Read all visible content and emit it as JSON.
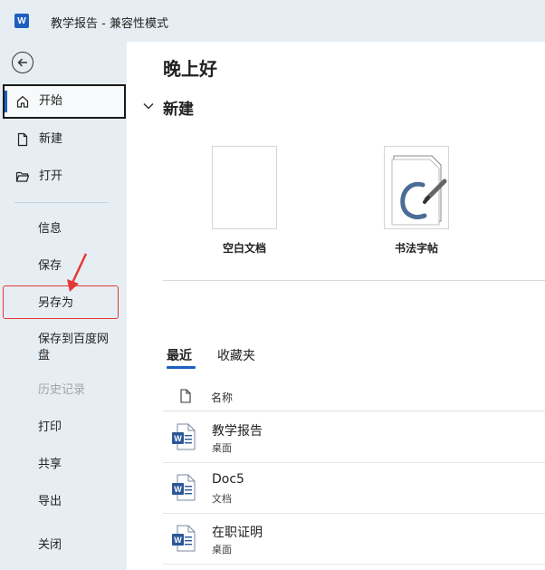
{
  "titlebar": {
    "app_letter": "W",
    "title": "教学报告  -  兼容性模式"
  },
  "sidebar": {
    "primary": [
      {
        "label": "开始",
        "icon": "home-icon",
        "active": true
      },
      {
        "label": "新建",
        "icon": "new-document-icon",
        "active": false
      },
      {
        "label": "打开",
        "icon": "folder-open-icon",
        "active": false
      }
    ],
    "secondary": [
      {
        "label": "信息",
        "disabled": false
      },
      {
        "label": "保存",
        "disabled": false
      },
      {
        "label": "另存为",
        "disabled": false,
        "highlighted": true
      },
      {
        "label": "保存到百度网盘",
        "disabled": false
      },
      {
        "label": "历史记录",
        "disabled": true
      },
      {
        "label": "打印",
        "disabled": false
      },
      {
        "label": "共享",
        "disabled": false
      },
      {
        "label": "导出",
        "disabled": false
      },
      {
        "label": "关闭",
        "disabled": false
      }
    ],
    "highlight_color": "#e53935"
  },
  "main": {
    "greeting": "晚上好",
    "new_section_title": "新建",
    "templates": [
      {
        "label": "空白文档",
        "icon": "blank-document-icon"
      },
      {
        "label": "书法字帖",
        "icon": "calligraphy-template-icon"
      }
    ],
    "tabs": [
      {
        "label": "最近",
        "active": true
      },
      {
        "label": "收藏夹",
        "active": false
      }
    ],
    "list_header": {
      "name_label": "名称"
    },
    "files": [
      {
        "name": "教学报告",
        "location": "桌面",
        "icon": "word-file-icon"
      },
      {
        "name": "Doc5",
        "location": "文档",
        "icon": "word-file-icon"
      },
      {
        "name": "在职证明",
        "location": "桌面",
        "icon": "word-file-icon"
      }
    ]
  },
  "colors": {
    "accent": "#1f5fbf",
    "sidebar_bg": "#e6eef4",
    "annotation_red": "#e53935"
  }
}
